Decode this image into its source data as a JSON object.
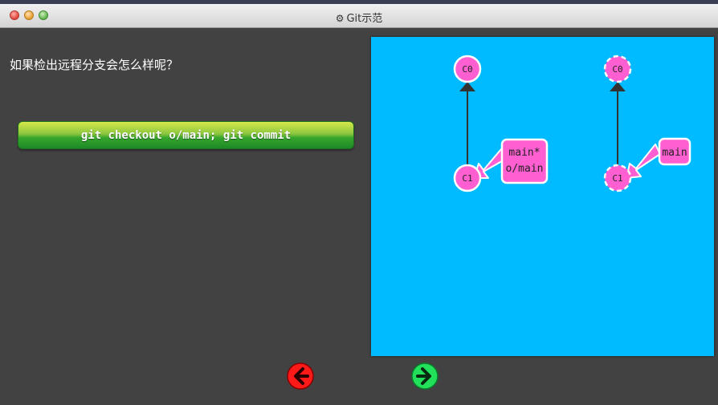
{
  "window": {
    "title": "Git示范",
    "title_icon": "gear-icon"
  },
  "lesson": {
    "question": "如果检出远程分支会怎么样呢？",
    "command": "git checkout o/main; git commit"
  },
  "colors": {
    "canvas_bg": "#00bbff",
    "commit_fill": "#ff5fd0",
    "branch_fill": "#ff5fd0",
    "back_button": "#ff1a1a",
    "forward_button": "#22e05a"
  },
  "graph_before": {
    "commits": [
      {
        "id": "C0"
      },
      {
        "id": "C1"
      }
    ],
    "branch_label_lines": [
      "main*",
      "o/main"
    ]
  },
  "graph_after": {
    "commits": [
      {
        "id": "C0"
      },
      {
        "id": "C1"
      }
    ],
    "branch_label_lines": [
      "main"
    ]
  },
  "nav": {
    "back_icon": "arrow-left-icon",
    "forward_icon": "arrow-right-icon"
  }
}
